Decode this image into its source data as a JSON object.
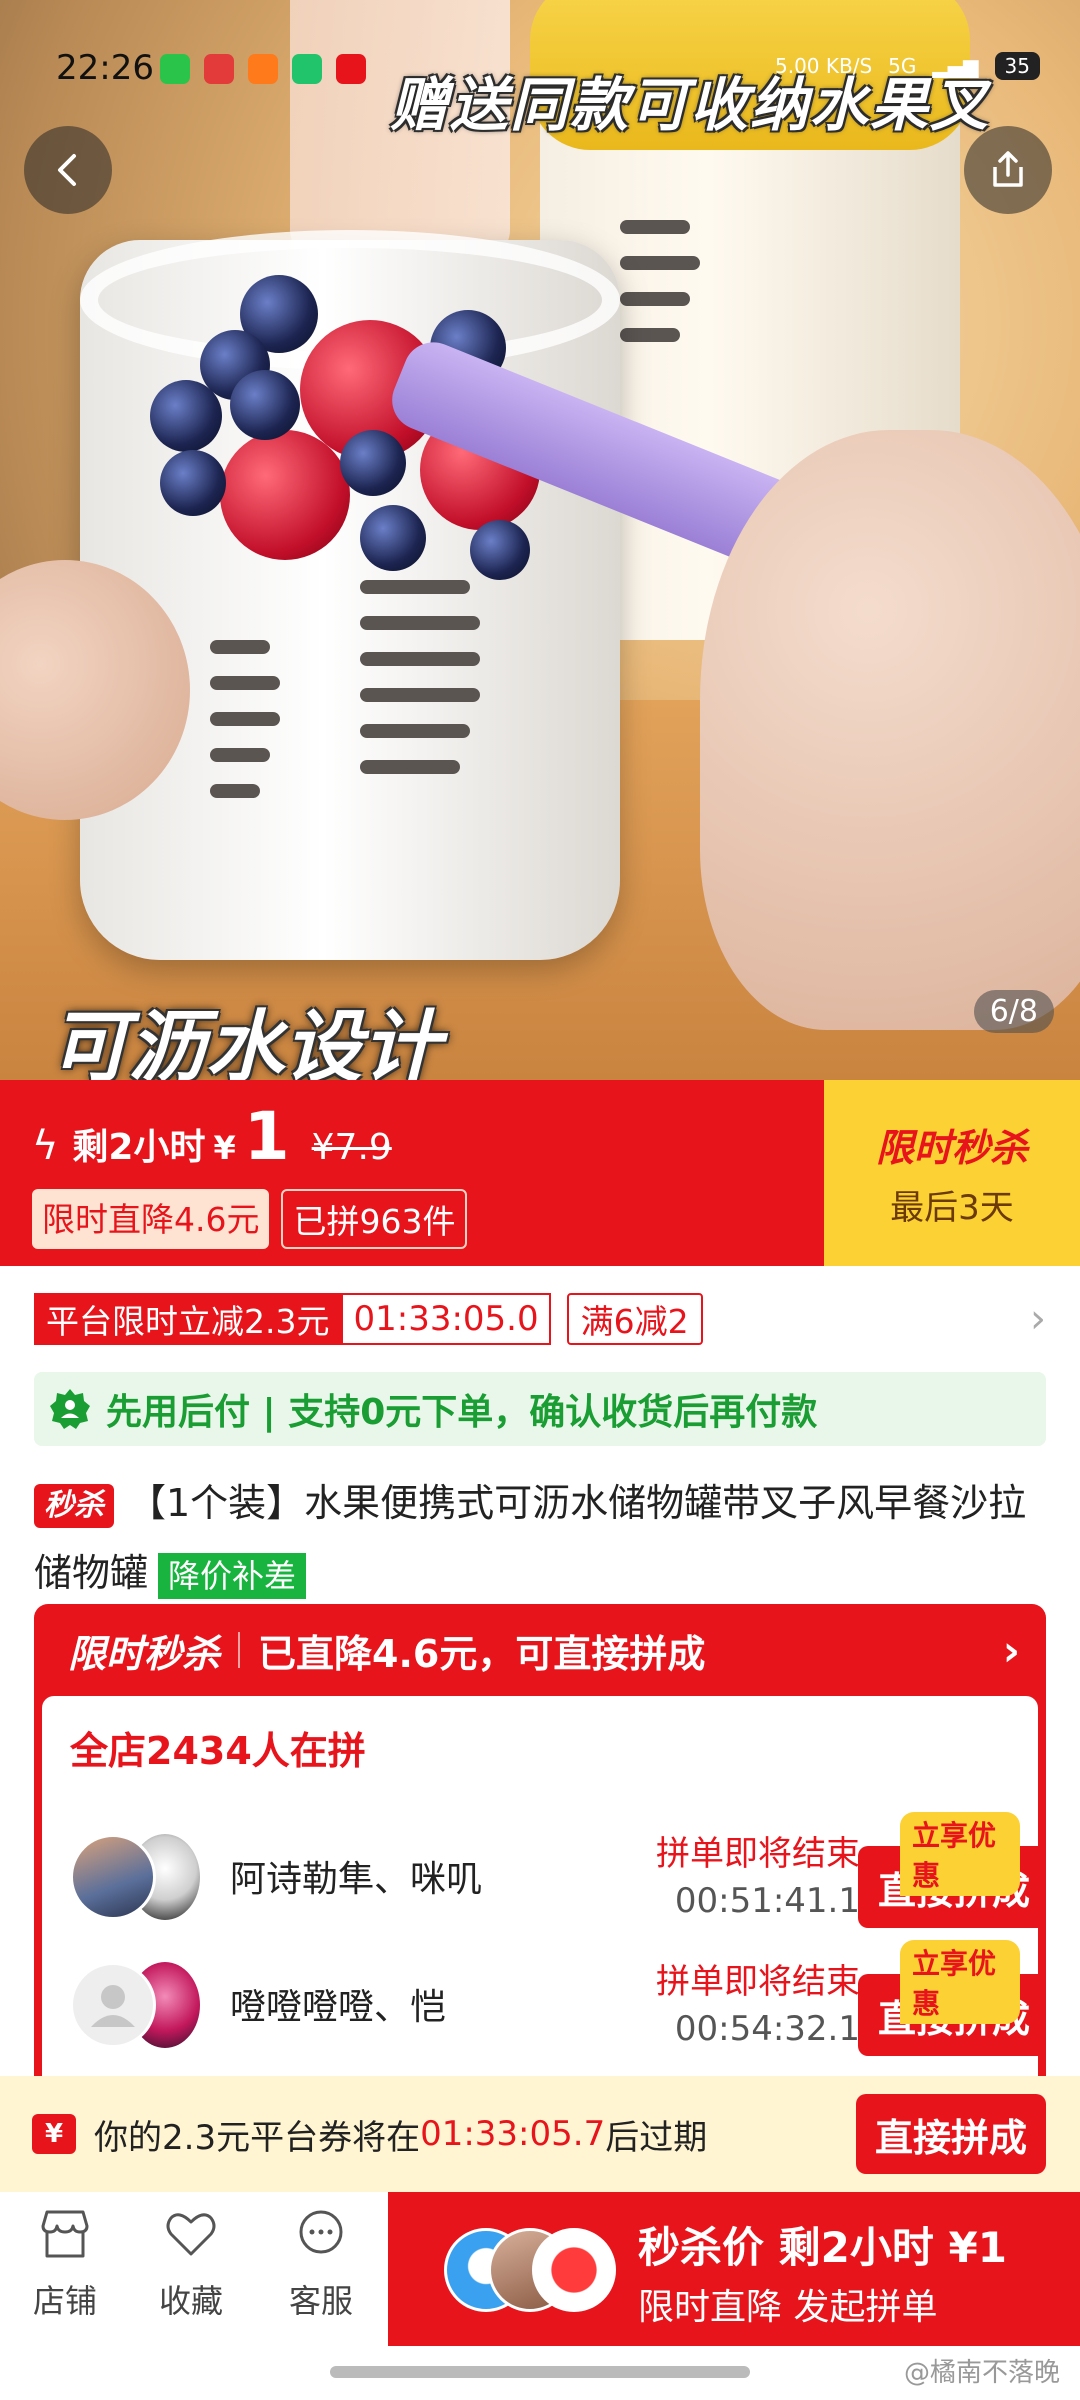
{
  "status_bar": {
    "time": "22:26",
    "network": "5G",
    "speed": "5.00 KB/S",
    "battery": "35"
  },
  "hero": {
    "caption_top": "赠送同款可收纳水果叉",
    "caption_bottom": "可沥水设计",
    "counter": "6/8"
  },
  "price_banner": {
    "remain_label": "剩2小时",
    "currency": "¥",
    "price": "1",
    "original_price": "¥7.9",
    "tag_drop": "限时直降4.6元",
    "tag_sold": "已拼963件",
    "flash_title": "限时秒杀",
    "flash_sub": "最后3天"
  },
  "coupon_row": {
    "discount": "平台限时立减2.3元",
    "countdown": "01:33:05.0",
    "full_reduction": "满6减2"
  },
  "paylater": {
    "text": "先用后付 | 支持0元下单，确认收货后再付款"
  },
  "product": {
    "seckill_badge": "秒杀",
    "title": "【1个装】水果便携式可沥水储物罐带叉子风早餐沙拉储物罐",
    "subsidy_badge": "降价补差"
  },
  "group_buy": {
    "head_label": "限时秒杀",
    "head_text": "已直降4.6元，可直接拼成",
    "count_text": "全店2434人在拼",
    "rows": [
      {
        "names": "阿诗勒隼、咪叽",
        "status": "拼单即将结束",
        "countdown": "00:51:41.1",
        "tag": "立享优惠",
        "button": "直接拼成"
      },
      {
        "names": "噔噔噔噔、恺",
        "status": "拼单即将结束",
        "countdown": "00:54:32.1",
        "tag": "立享优惠",
        "button": "直接拼成"
      }
    ]
  },
  "expiry_bar": {
    "icon": "¥",
    "text_before": "你的2.3元平台券将在",
    "time": "01:33:05.7",
    "text_after": "后过期",
    "button": "直接拼成"
  },
  "bottom_bar": {
    "shop": "店铺",
    "favorite": "收藏",
    "service": "客服",
    "cta_line1": "秒杀价 剩2小时 ¥1",
    "cta_line2": "限时直降 发起拼单"
  },
  "watermark": "@橘南不落晚",
  "colors": {
    "brand_red": "#e8141c",
    "flash_yellow": "#fcd133",
    "pay_green": "#1a9d33"
  }
}
